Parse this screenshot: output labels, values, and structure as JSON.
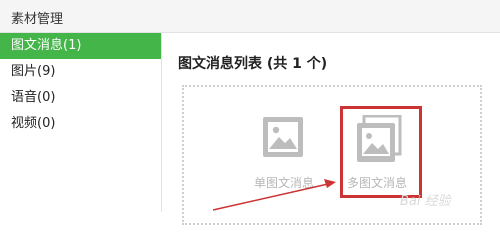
{
  "topbar": {
    "title": "素材管理"
  },
  "sidebar": {
    "items": [
      {
        "label": "图文消息(1)"
      },
      {
        "label": "图片(9)"
      },
      {
        "label": "语音(0)"
      },
      {
        "label": "视频(0)"
      }
    ]
  },
  "main": {
    "list_title": "图文消息列表 (共 1 个)",
    "single_label": "单图文消息",
    "multi_label": "多图文消息"
  },
  "colors": {
    "active_green": "#44b549",
    "highlight_red": "#cc3333"
  },
  "watermark": "Bai 经验"
}
